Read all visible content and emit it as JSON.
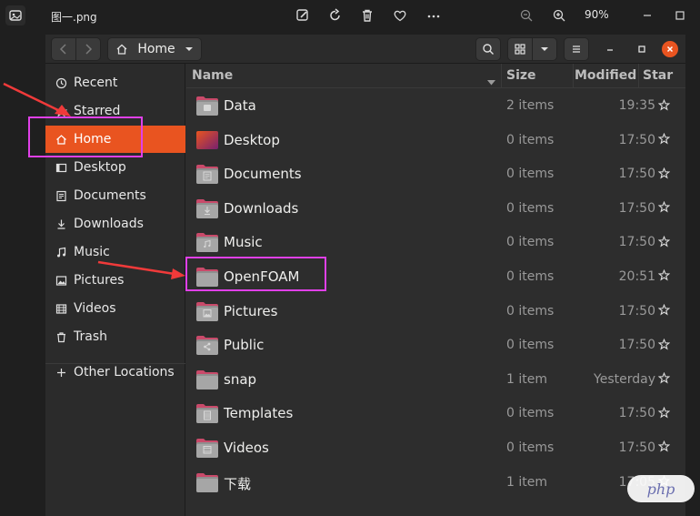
{
  "viewer": {
    "filename": "图一.png",
    "zoom": "90%",
    "tools": [
      "edit-icon",
      "rotate-icon",
      "delete-icon",
      "favorite-icon",
      "more-icon",
      "zoom-out-icon",
      "zoom-in-icon"
    ]
  },
  "headerbar": {
    "path_label": "Home"
  },
  "sidebar": {
    "items": [
      {
        "label": "Recent",
        "icon": "clock-icon"
      },
      {
        "label": "Starred",
        "icon": "star-icon"
      },
      {
        "label": "Home",
        "icon": "home-icon",
        "active": true
      },
      {
        "label": "Desktop",
        "icon": "desktop-icon"
      },
      {
        "label": "Documents",
        "icon": "document-icon"
      },
      {
        "label": "Downloads",
        "icon": "download-icon"
      },
      {
        "label": "Music",
        "icon": "music-icon"
      },
      {
        "label": "Pictures",
        "icon": "picture-icon"
      },
      {
        "label": "Videos",
        "icon": "video-icon"
      },
      {
        "label": "Trash",
        "icon": "trash-icon"
      }
    ],
    "other_locations": "Other Locations"
  },
  "columns": {
    "name": "Name",
    "size": "Size",
    "modified": "Modified",
    "star": "Star"
  },
  "files": [
    {
      "name": "Data",
      "size": "2 items",
      "modified": "19:35",
      "emblem": "drive"
    },
    {
      "name": "Desktop",
      "size": "0 items",
      "modified": "17:50",
      "emblem": "desktop"
    },
    {
      "name": "Documents",
      "size": "0 items",
      "modified": "17:50",
      "emblem": "document"
    },
    {
      "name": "Downloads",
      "size": "0 items",
      "modified": "17:50",
      "emblem": "download"
    },
    {
      "name": "Music",
      "size": "0 items",
      "modified": "17:50",
      "emblem": "music"
    },
    {
      "name": "OpenFOAM",
      "size": "0 items",
      "modified": "20:51",
      "emblem": "none"
    },
    {
      "name": "Pictures",
      "size": "0 items",
      "modified": "17:50",
      "emblem": "picture"
    },
    {
      "name": "Public",
      "size": "0 items",
      "modified": "17:50",
      "emblem": "share"
    },
    {
      "name": "snap",
      "size": "1 item",
      "modified": "Yesterday",
      "emblem": "none"
    },
    {
      "name": "Templates",
      "size": "0 items",
      "modified": "17:50",
      "emblem": "template"
    },
    {
      "name": "Videos",
      "size": "0 items",
      "modified": "17:50",
      "emblem": "video"
    },
    {
      "name": "下载",
      "size": "1 item",
      "modified": "17:05",
      "emblem": "none"
    }
  ],
  "watermark": "php",
  "colors": {
    "accent": "#e95420",
    "annotation": "#e040e8",
    "arrow": "#f03a3a"
  }
}
